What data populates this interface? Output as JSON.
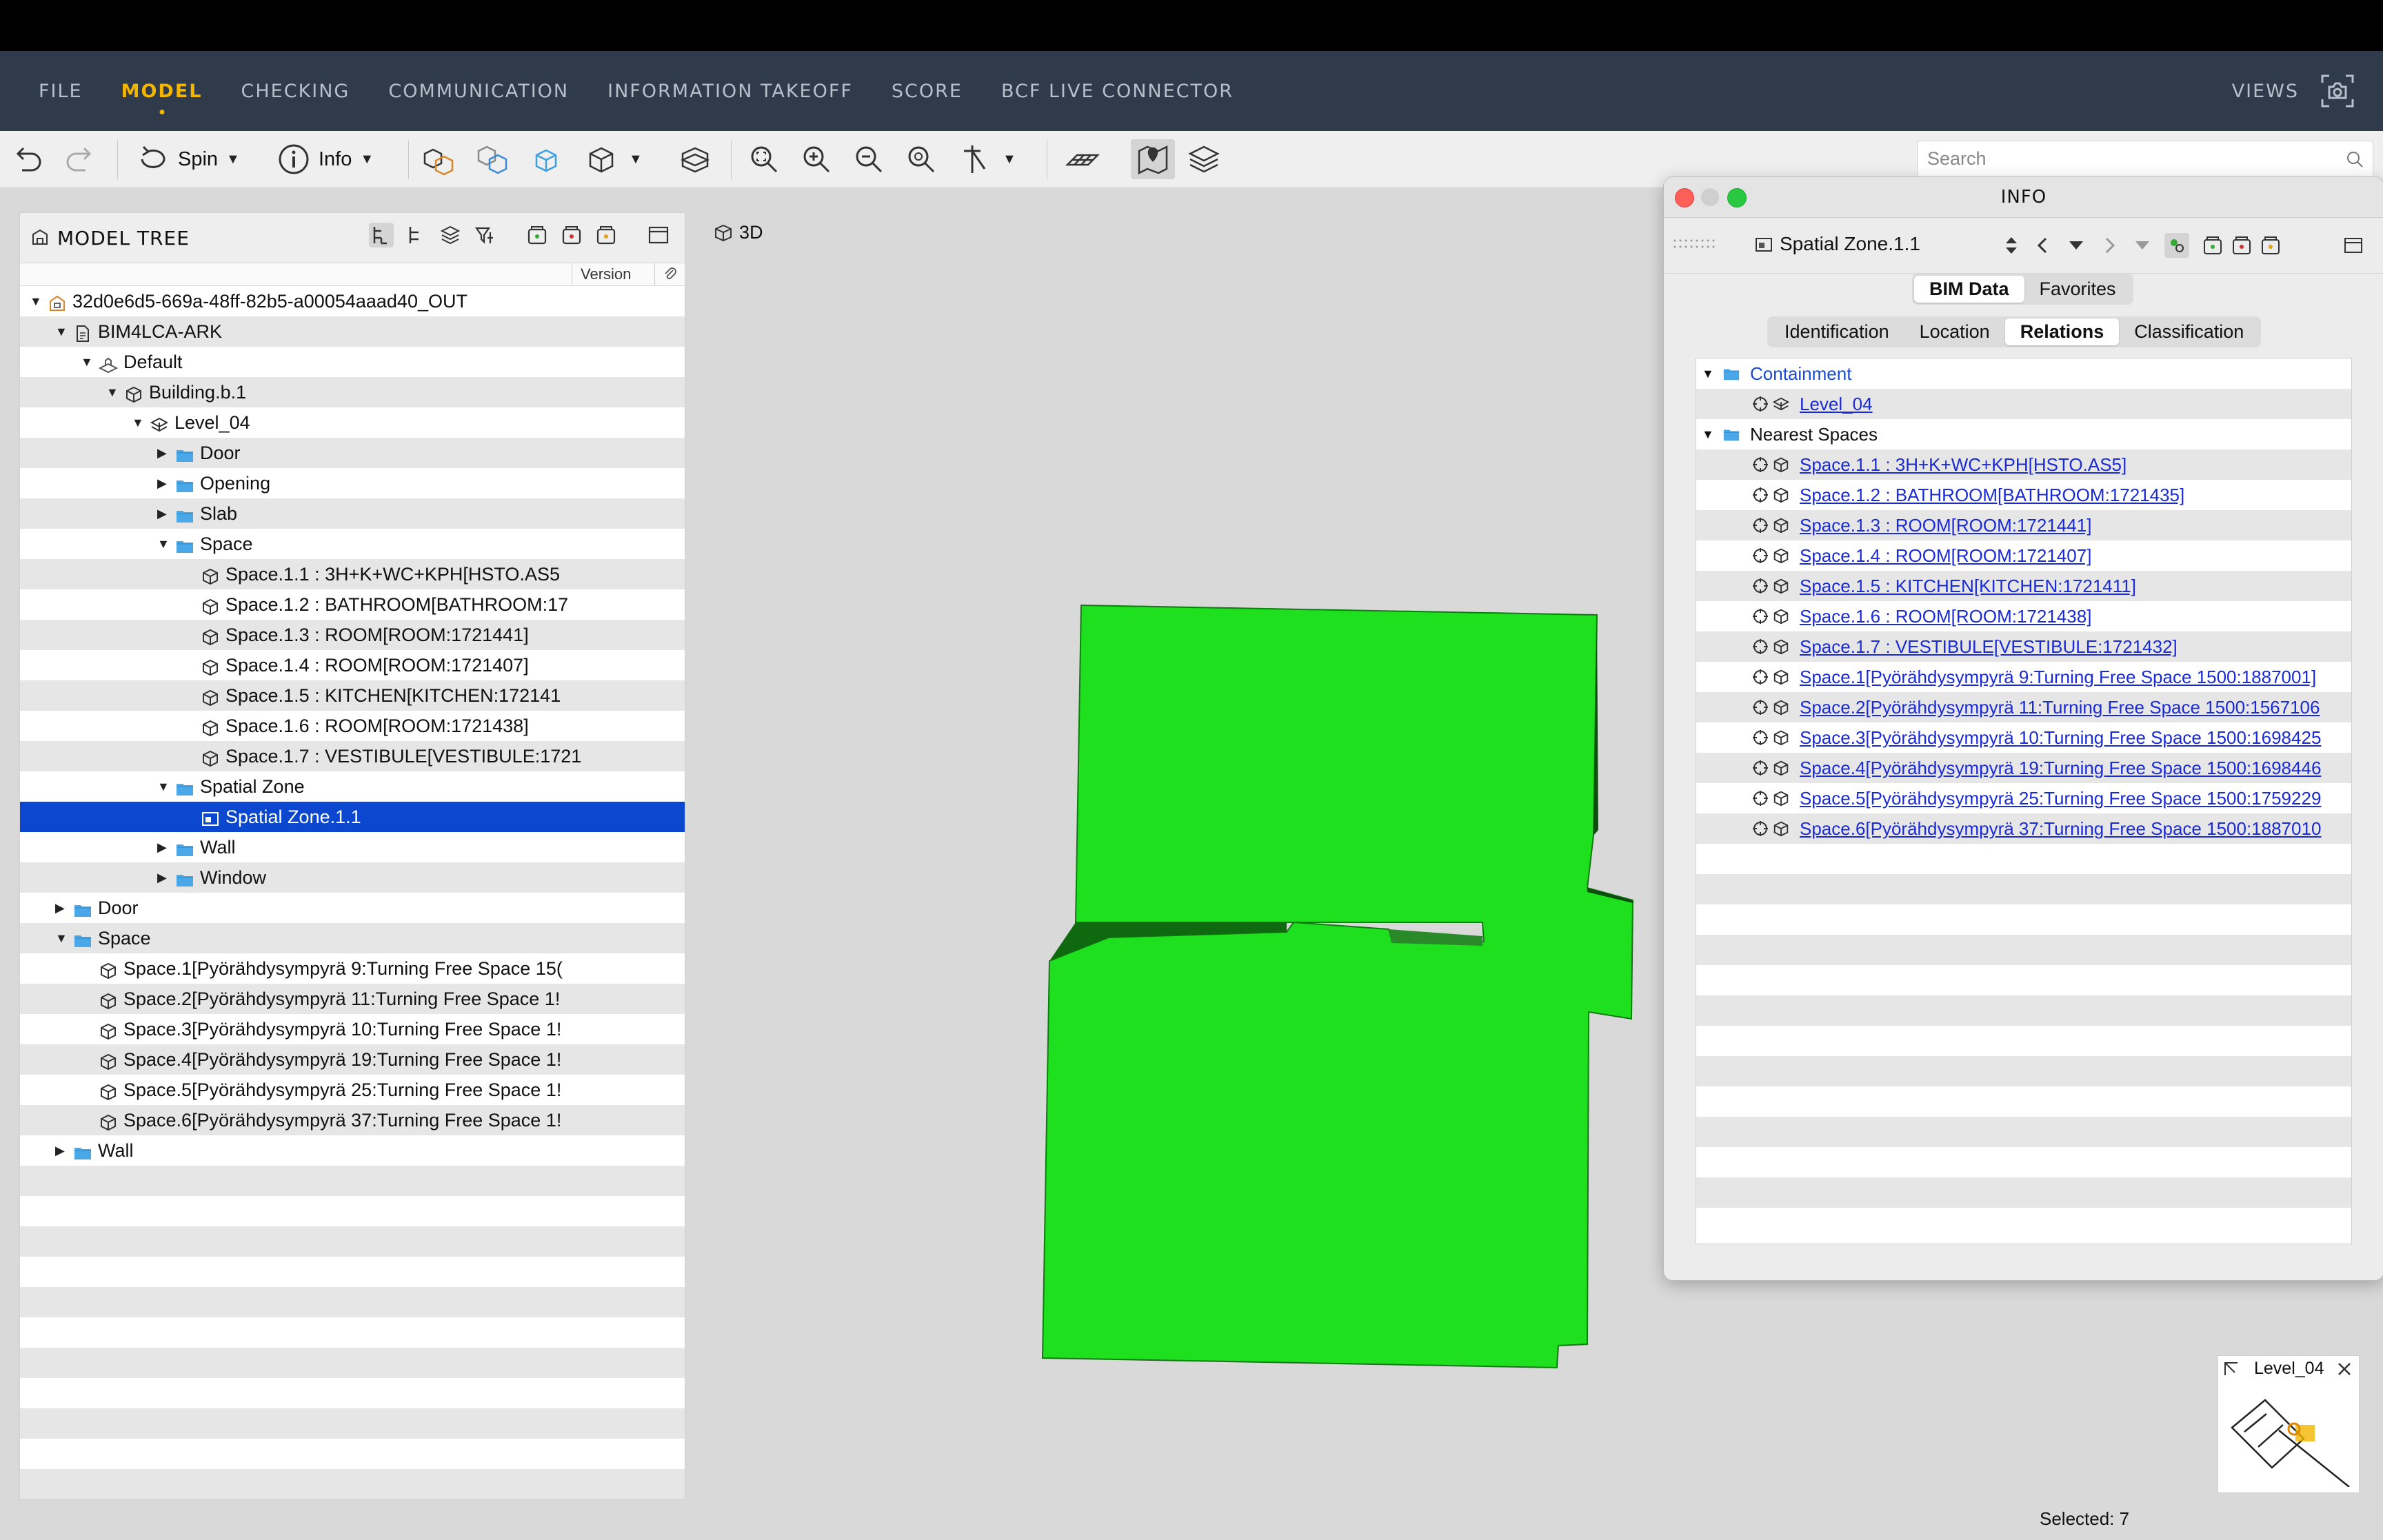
{
  "menu": {
    "items": [
      "FILE",
      "MODEL",
      "CHECKING",
      "COMMUNICATION",
      "INFORMATION TAKEOFF",
      "SCORE",
      "BCF LIVE CONNECTOR"
    ],
    "active": "MODEL",
    "views": "VIEWS"
  },
  "toolbar": {
    "spin_label": "Spin",
    "info_label": "Info",
    "search_placeholder": "Search"
  },
  "model_tree": {
    "title": "MODEL TREE",
    "version_col": "Version",
    "rows": [
      {
        "label": "32d0e6d5-669a-48ff-82b5-a00054aaad40_OUT",
        "toggle": "▼",
        "icon": "model-file-icon"
      },
      {
        "label": "BIM4LCA-ARK",
        "toggle": "▼",
        "icon": "document-icon"
      },
      {
        "label": "Default",
        "toggle": "▼",
        "icon": "site-icon"
      },
      {
        "label": "Building.b.1",
        "toggle": "▼",
        "icon": "cube-icon"
      },
      {
        "label": "Level_04",
        "toggle": "▼",
        "icon": "level-icon"
      },
      {
        "label": "Door",
        "toggle": "▶",
        "icon": "folder-icon"
      },
      {
        "label": "Opening",
        "toggle": "▶",
        "icon": "folder-icon"
      },
      {
        "label": "Slab",
        "toggle": "▶",
        "icon": "folder-icon"
      },
      {
        "label": "Space",
        "toggle": "▼",
        "icon": "folder-icon"
      },
      {
        "label": "Space.1.1 : 3H+K+WC+KPH[HSTO.AS5",
        "toggle": "",
        "icon": "cube-icon"
      },
      {
        "label": "Space.1.2 : BATHROOM[BATHROOM:17",
        "toggle": "",
        "icon": "cube-icon"
      },
      {
        "label": "Space.1.3 : ROOM[ROOM:1721441]",
        "toggle": "",
        "icon": "cube-icon"
      },
      {
        "label": "Space.1.4 : ROOM[ROOM:1721407]",
        "toggle": "",
        "icon": "cube-icon"
      },
      {
        "label": "Space.1.5 : KITCHEN[KITCHEN:172141",
        "toggle": "",
        "icon": "cube-icon"
      },
      {
        "label": "Space.1.6 : ROOM[ROOM:1721438]",
        "toggle": "",
        "icon": "cube-icon"
      },
      {
        "label": "Space.1.7 : VESTIBULE[VESTIBULE:1721",
        "toggle": "",
        "icon": "cube-icon"
      },
      {
        "label": "Spatial Zone",
        "toggle": "▼",
        "icon": "folder-icon"
      },
      {
        "label": "Spatial Zone.1.1",
        "toggle": "",
        "icon": "zone-icon"
      },
      {
        "label": "Wall",
        "toggle": "▶",
        "icon": "folder-icon"
      },
      {
        "label": "Window",
        "toggle": "▶",
        "icon": "folder-icon"
      },
      {
        "label": "Door",
        "toggle": "▶",
        "icon": "folder-icon"
      },
      {
        "label": "Space",
        "toggle": "▼",
        "icon": "folder-icon"
      },
      {
        "label": "Space.1[Pyörähdysympyrä 9:Turning Free Space 15(",
        "toggle": "",
        "icon": "cube-icon"
      },
      {
        "label": "Space.2[Pyörähdysympyrä 11:Turning Free Space 1!",
        "toggle": "",
        "icon": "cube-icon"
      },
      {
        "label": "Space.3[Pyörähdysympyrä 10:Turning Free Space 1!",
        "toggle": "",
        "icon": "cube-icon"
      },
      {
        "label": "Space.4[Pyörähdysympyrä 19:Turning Free Space 1!",
        "toggle": "",
        "icon": "cube-icon"
      },
      {
        "label": "Space.5[Pyörähdysympyrä 25:Turning Free Space 1!",
        "toggle": "",
        "icon": "cube-icon"
      },
      {
        "label": "Space.6[Pyörähdysympyrä 37:Turning Free Space 1!",
        "toggle": "",
        "icon": "cube-icon"
      },
      {
        "label": "Wall",
        "toggle": "▶",
        "icon": "folder-icon"
      }
    ],
    "selected_label": "Spatial Zone.1.1"
  },
  "viewport": {
    "view_label": "3D",
    "geometry_color": "#1ee01e"
  },
  "info": {
    "title": "INFO",
    "selected_name": "Spatial Zone.1.1",
    "tabs": [
      "BIM Data",
      "Favorites"
    ],
    "active_tab": "BIM Data",
    "subtabs": [
      "Identification",
      "Location",
      "Relations",
      "Classification"
    ],
    "active_subtab": "Relations",
    "containment_label": "Containment",
    "containment_items": [
      "Level_04"
    ],
    "nearest_label": "Nearest Spaces",
    "nearest_items": [
      "Space.1.1 : 3H+K+WC+KPH[HSTO.AS5]",
      "Space.1.2 : BATHROOM[BATHROOM:1721435]",
      "Space.1.3 : ROOM[ROOM:1721441]",
      "Space.1.4 : ROOM[ROOM:1721407]",
      "Space.1.5 : KITCHEN[KITCHEN:1721411]",
      "Space.1.6 : ROOM[ROOM:1721438]",
      "Space.1.7 : VESTIBULE[VESTIBULE:1721432]",
      "Space.1[Pyörähdysympyrä 9:Turning Free Space 1500:1887001]",
      "Space.2[Pyörähdysympyrä 11:Turning Free Space 1500:1567106",
      "Space.3[Pyörähdysympyrä 10:Turning Free Space 1500:1698425",
      "Space.4[Pyörähdysympyrä 19:Turning Free Space 1500:1698446",
      "Space.5[Pyörähdysympyrä 25:Turning Free Space 1500:1759229",
      "Space.6[Pyörähdysympyrä 37:Turning Free Space 1500:1887010"
    ]
  },
  "minimap": {
    "level": "Level_04"
  },
  "status": {
    "selected": "Selected: 7"
  }
}
